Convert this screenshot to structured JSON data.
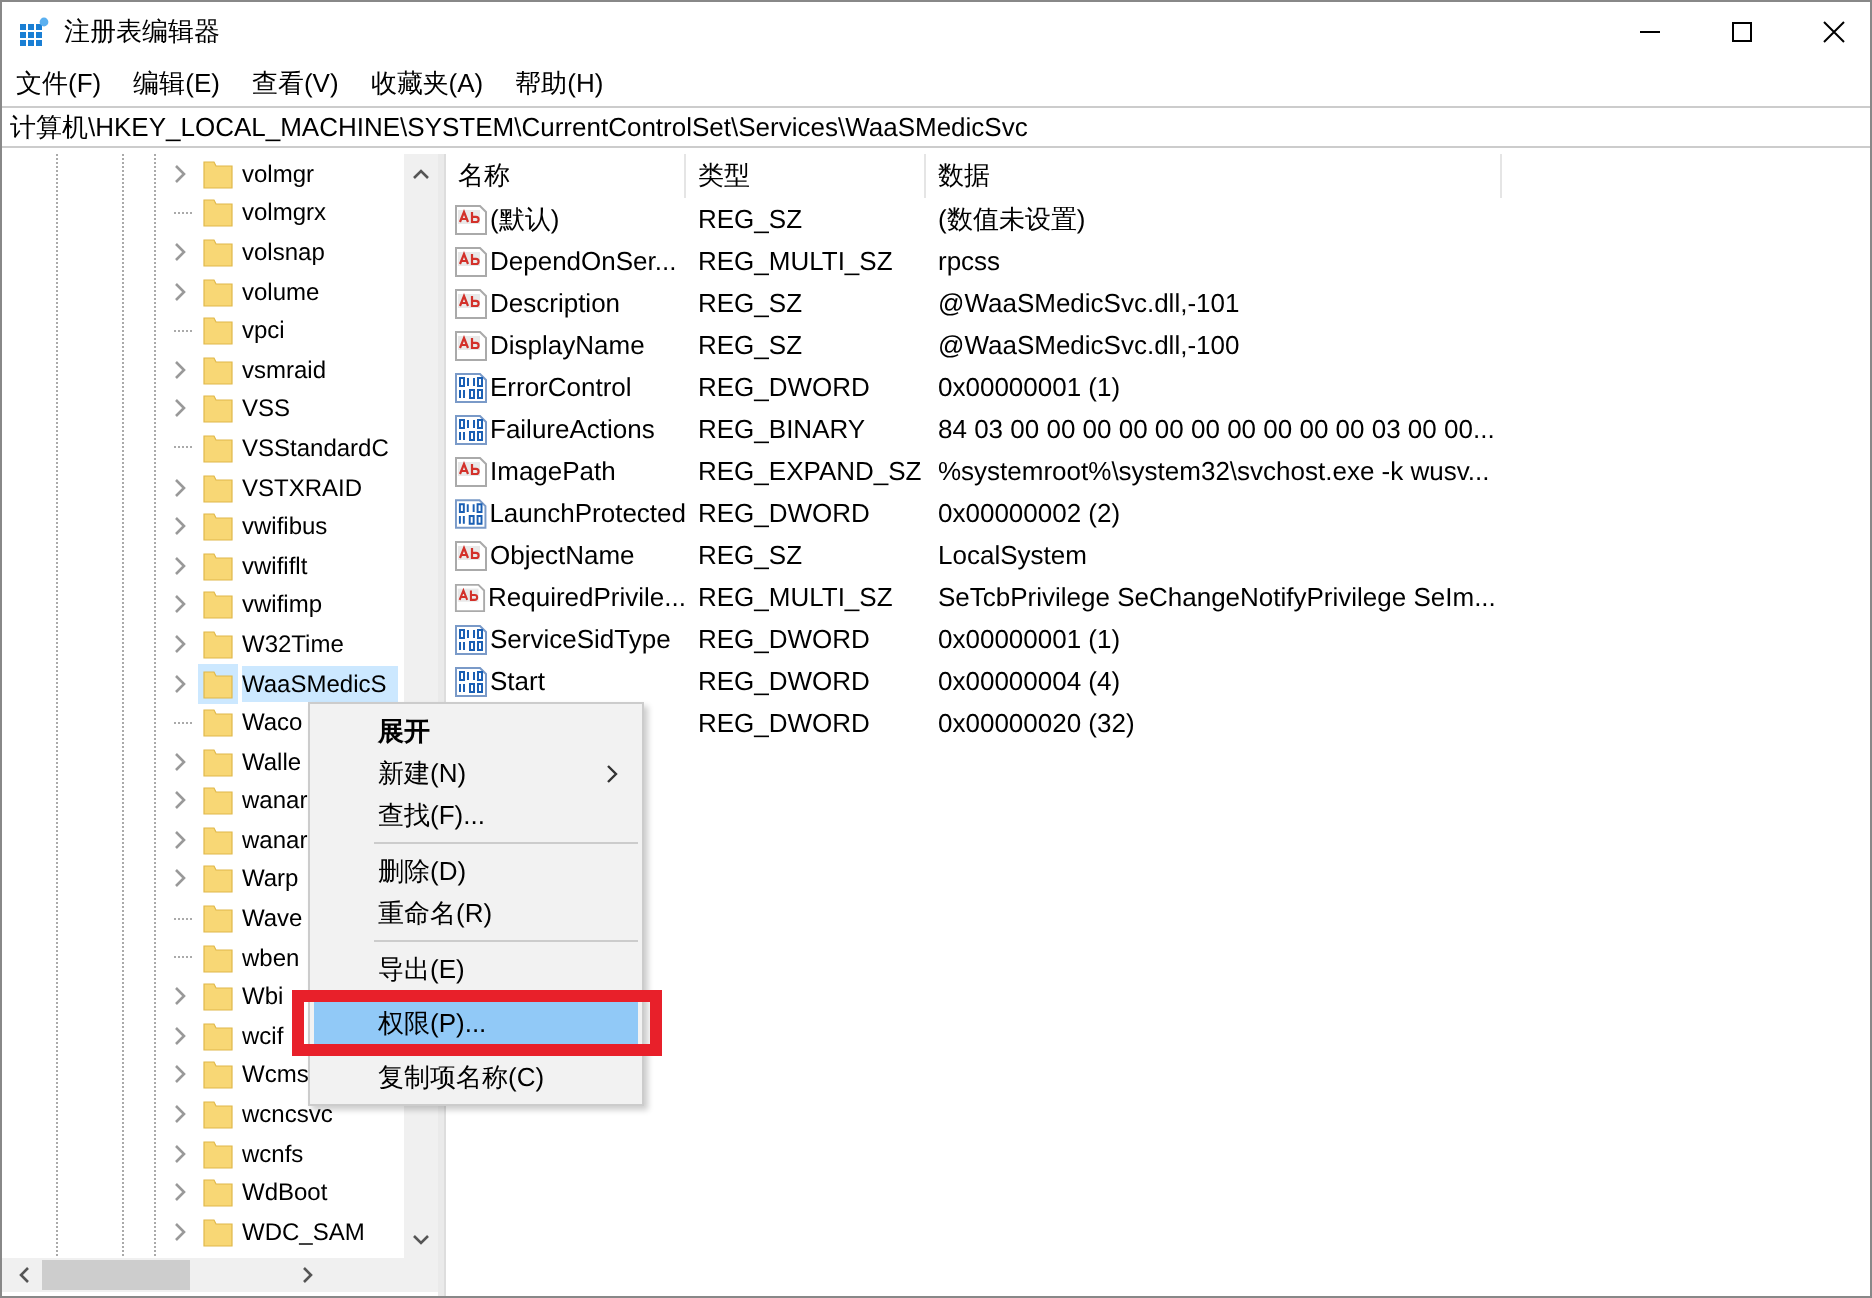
{
  "window": {
    "title": "注册表编辑器"
  },
  "menu_bar": [
    "文件(F)",
    "编辑(E)",
    "查看(V)",
    "收藏夹(A)",
    "帮助(H)"
  ],
  "address": "计算机\\HKEY_LOCAL_MACHINE\\SYSTEM\\CurrentControlSet\\Services\\WaaSMedicSvc",
  "tree": {
    "items": [
      {
        "label": "volmgr",
        "expandable": true,
        "selected": false
      },
      {
        "label": "volmgrx",
        "expandable": false,
        "selected": false
      },
      {
        "label": "volsnap",
        "expandable": true,
        "selected": false
      },
      {
        "label": "volume",
        "expandable": true,
        "selected": false
      },
      {
        "label": "vpci",
        "expandable": false,
        "selected": false
      },
      {
        "label": "vsmraid",
        "expandable": true,
        "selected": false
      },
      {
        "label": "VSS",
        "expandable": true,
        "selected": false
      },
      {
        "label": "VSStandardC",
        "expandable": false,
        "selected": false
      },
      {
        "label": "VSTXRAID",
        "expandable": true,
        "selected": false
      },
      {
        "label": "vwifibus",
        "expandable": true,
        "selected": false
      },
      {
        "label": "vwififlt",
        "expandable": true,
        "selected": false
      },
      {
        "label": "vwifimp",
        "expandable": true,
        "selected": false
      },
      {
        "label": "W32Time",
        "expandable": true,
        "selected": false
      },
      {
        "label": "WaaSMedicS",
        "expandable": true,
        "selected": true
      },
      {
        "label": "Waco",
        "expandable": false,
        "selected": false
      },
      {
        "label": "Walle",
        "expandable": true,
        "selected": false
      },
      {
        "label": "wanar",
        "expandable": true,
        "selected": false
      },
      {
        "label": "wanar",
        "expandable": true,
        "selected": false
      },
      {
        "label": "Warp",
        "expandable": true,
        "selected": false
      },
      {
        "label": "Wave",
        "expandable": false,
        "selected": false
      },
      {
        "label": "wben",
        "expandable": false,
        "selected": false
      },
      {
        "label": "Wbi",
        "expandable": true,
        "selected": false
      },
      {
        "label": "wcif",
        "expandable": true,
        "selected": false
      },
      {
        "label": "Wcms",
        "expandable": true,
        "selected": false
      },
      {
        "label": "wcncsvc",
        "expandable": true,
        "selected": false
      },
      {
        "label": "wcnfs",
        "expandable": true,
        "selected": false
      },
      {
        "label": "WdBoot",
        "expandable": true,
        "selected": false
      },
      {
        "label": "WDC_SAM",
        "expandable": true,
        "selected": false
      }
    ]
  },
  "values": {
    "columns": [
      "名称",
      "类型",
      "数据"
    ],
    "rows": [
      {
        "kind": "string",
        "name": "(默认)",
        "type": "REG_SZ",
        "data": "(数值未设置)"
      },
      {
        "kind": "string",
        "name": "DependOnSer...",
        "type": "REG_MULTI_SZ",
        "data": "rpcss"
      },
      {
        "kind": "string",
        "name": "Description",
        "type": "REG_SZ",
        "data": "@WaaSMedicSvc.dll,-101"
      },
      {
        "kind": "string",
        "name": "DisplayName",
        "type": "REG_SZ",
        "data": "@WaaSMedicSvc.dll,-100"
      },
      {
        "kind": "binary",
        "name": "ErrorControl",
        "type": "REG_DWORD",
        "data": "0x00000001 (1)"
      },
      {
        "kind": "binary",
        "name": "FailureActions",
        "type": "REG_BINARY",
        "data": "84 03 00 00 00 00 00 00 00 00 00 00 03 00 00..."
      },
      {
        "kind": "string",
        "name": "ImagePath",
        "type": "REG_EXPAND_SZ",
        "data": "%systemroot%\\system32\\svchost.exe -k wusv..."
      },
      {
        "kind": "binary",
        "name": "LaunchProtected",
        "type": "REG_DWORD",
        "data": "0x00000002 (2)"
      },
      {
        "kind": "string",
        "name": "ObjectName",
        "type": "REG_SZ",
        "data": "LocalSystem"
      },
      {
        "kind": "string",
        "name": "RequiredPrivile...",
        "type": "REG_MULTI_SZ",
        "data": "SeTcbPrivilege SeChangeNotifyPrivilege SeIm..."
      },
      {
        "kind": "binary",
        "name": "ServiceSidType",
        "type": "REG_DWORD",
        "data": "0x00000001 (1)"
      },
      {
        "kind": "binary",
        "name": "Start",
        "type": "REG_DWORD",
        "data": "0x00000004 (4)"
      },
      {
        "type": "REG_DWORD",
        "data": "0x00000020 (32)"
      }
    ]
  },
  "context_menu": [
    {
      "kind": "item",
      "label": "展开",
      "bold": true,
      "submenu": false,
      "selected": false
    },
    {
      "kind": "item",
      "label": "新建(N)",
      "bold": false,
      "submenu": true,
      "selected": false
    },
    {
      "kind": "item",
      "label": "查找(F)...",
      "bold": false,
      "submenu": false,
      "selected": false
    },
    {
      "kind": "separator"
    },
    {
      "kind": "item",
      "label": "删除(D)",
      "bold": false,
      "submenu": false,
      "selected": false
    },
    {
      "kind": "item",
      "label": "重命名(R)",
      "bold": false,
      "submenu": false,
      "selected": false
    },
    {
      "kind": "separator"
    },
    {
      "kind": "item",
      "label": "导出(E)",
      "bold": false,
      "submenu": false,
      "selected": false
    },
    {
      "kind": "item",
      "label": "权限(P)...",
      "bold": false,
      "submenu": false,
      "selected": true
    },
    {
      "kind": "item",
      "label": "复制项名称(C)",
      "bold": false,
      "submenu": false,
      "selected": false
    }
  ]
}
